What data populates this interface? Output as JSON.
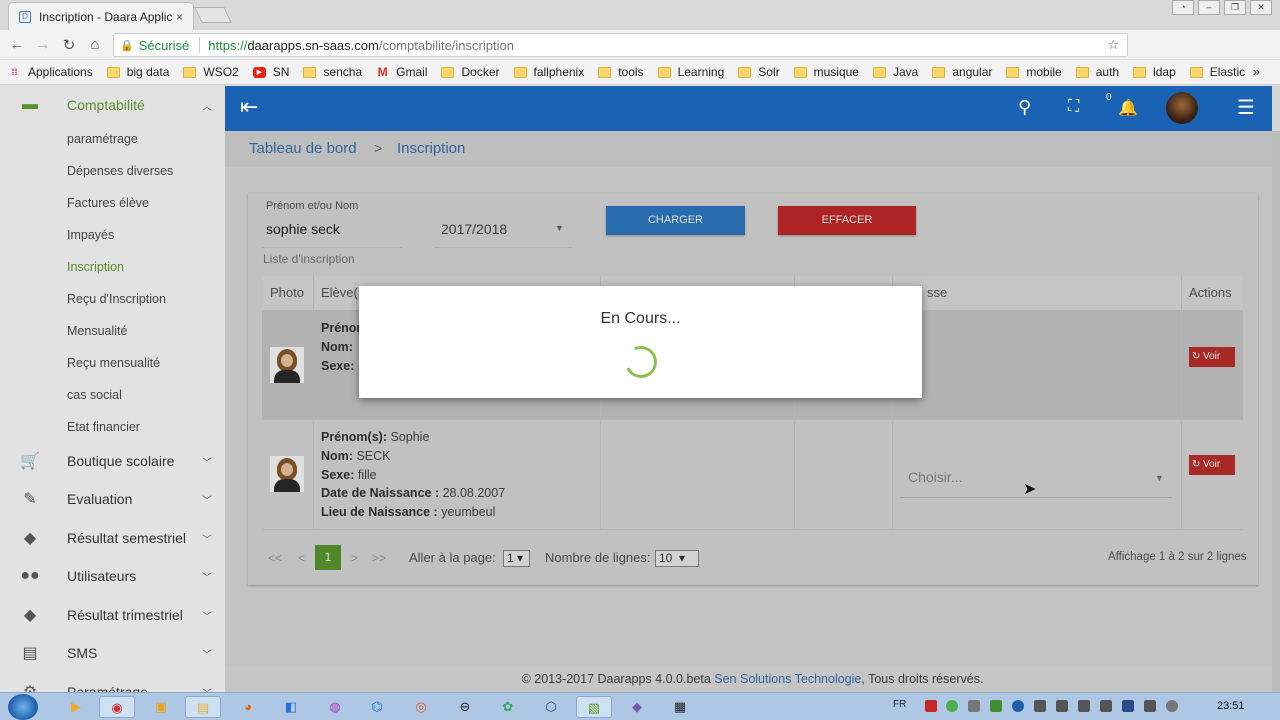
{
  "browser": {
    "tab_title": "Inscription - Daara Applic",
    "tab_close": "×",
    "back": "←",
    "forward": "→",
    "reload": "↻",
    "home": "⌂",
    "secure_label": "Sécurisé",
    "url_scheme": "https://",
    "url_host": "daarapps.sn-saas.com",
    "url_path": "/comptabilite/inscription",
    "star": "☆",
    "more": "⋮"
  },
  "bookmarks": {
    "items": [
      {
        "label": "Applications",
        "icon": "apps-grid-icon"
      },
      {
        "label": "big data",
        "icon": "folder-icon"
      },
      {
        "label": "WSO2",
        "icon": "folder-icon"
      },
      {
        "label": "SN",
        "icon": "youtube-icon"
      },
      {
        "label": "sencha",
        "icon": "folder-icon"
      },
      {
        "label": "Gmail",
        "icon": "gmail-icon"
      },
      {
        "label": "Docker",
        "icon": "folder-icon"
      },
      {
        "label": "fallphenix",
        "icon": "folder-icon"
      },
      {
        "label": "tools",
        "icon": "folder-icon"
      },
      {
        "label": "Learning",
        "icon": "folder-icon"
      },
      {
        "label": "Solr",
        "icon": "folder-icon"
      },
      {
        "label": "musique",
        "icon": "folder-icon"
      },
      {
        "label": "Java",
        "icon": "folder-icon"
      },
      {
        "label": "angular",
        "icon": "folder-icon"
      },
      {
        "label": "mobile",
        "icon": "folder-icon"
      },
      {
        "label": "auth",
        "icon": "folder-icon"
      },
      {
        "label": "ldap",
        "icon": "folder-icon"
      },
      {
        "label": "Elastic",
        "icon": "folder-icon"
      }
    ],
    "overflow": "»"
  },
  "sidebar": {
    "comptabilite": {
      "label": "Comptabilité",
      "icon": "credit-card-icon"
    },
    "sub_items": [
      "paramétrage",
      "Dépenses diverses",
      "Factures élève",
      "Impayés",
      "Inscription",
      "Reçu d'Inscription",
      "Mensualité",
      "Reçu mensualité",
      "cas social",
      "Etat financier"
    ],
    "active_item": "Inscription",
    "sections": [
      {
        "label": "Boutique scolaire",
        "icon": "cart-icon"
      },
      {
        "label": "Evaluation",
        "icon": "pencil-icon"
      },
      {
        "label": "Résultat semestriel",
        "icon": "graduation-cap-icon"
      },
      {
        "label": "Utilisateurs",
        "icon": "people-icon"
      },
      {
        "label": "Résultat trimestriel",
        "icon": "graduation-cap-icon"
      },
      {
        "label": "SMS",
        "icon": "message-icon"
      },
      {
        "label": "Paramétrage",
        "icon": "settings-icon"
      }
    ]
  },
  "topbar": {
    "notification_count": "0"
  },
  "breadcrumb": {
    "home": "Tableau de bord",
    "separator": ">",
    "current": "Inscription"
  },
  "form": {
    "name_label": "Prénom et/ou Nom",
    "name_value": "sophie seck",
    "year_value": "2017/2018",
    "load_button": "CHARGER",
    "clear_button": "EFFACER"
  },
  "list": {
    "title": "Liste d'inscription",
    "columns": [
      "Photo",
      "Elève(",
      "",
      "",
      "sse",
      "Actions"
    ],
    "rows": [
      {
        "prenom_label": "Prénom",
        "nom_label": "Nom:",
        "sexe_label": "Sexe:",
        "action": "Voir"
      },
      {
        "prenom_label": "Prénom(s):",
        "prenom": "Sophie",
        "nom_label": "Nom:",
        "nom": "SECK",
        "sexe_label": "Sexe:",
        "sexe": "fille",
        "naissance_label": "Date de Naissance :",
        "naissance": "28.08.2007",
        "lieu_label": "Lieu de Naissance :",
        "lieu": "yeumbeul",
        "classe_placeholder": "Choisir...",
        "action": "Voir"
      }
    ]
  },
  "pagination": {
    "first": "<<",
    "prev": "<",
    "current_page": "1",
    "next": ">",
    "last": ">>",
    "goto_label": "Aller à la page:",
    "goto_value": "1",
    "rows_label": "Nombre de lignes:",
    "rows_value": "10",
    "summary": "Affichage 1 à 2 sur 2 lignes"
  },
  "modal": {
    "text": "En Cours..."
  },
  "footer": {
    "text": "© 2013-2017 Daarapps 4.0.0.beta",
    "link": "Sen Solutions Technologie",
    "suffix": ", Tous droits réservés."
  },
  "taskbar": {
    "lang": "FR",
    "time": "23:51"
  },
  "colors": {
    "topbar": "#1a62b3",
    "accent_green": "#5a8f2f",
    "charger_btn": "#2e7cc7",
    "effacer_btn": "#c62828",
    "voir_btn": "#c0302c",
    "link": "#3a73b5"
  }
}
